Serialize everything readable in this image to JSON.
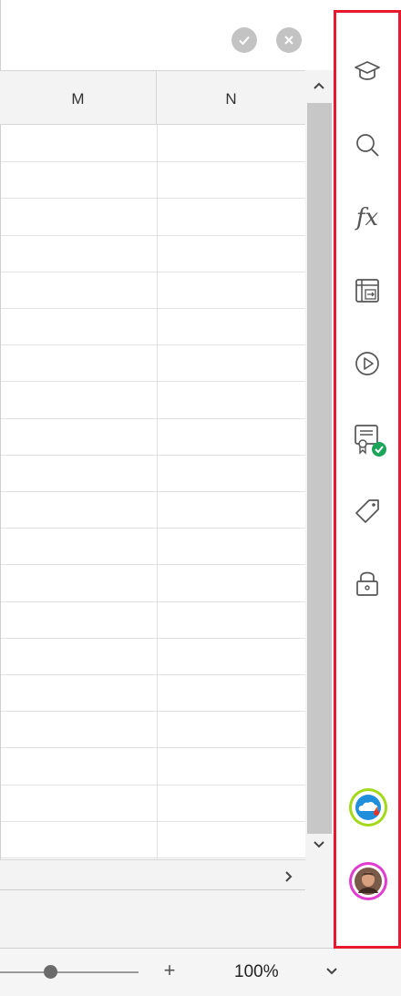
{
  "formula_bar": {
    "confirm_icon": "checkmark-icon",
    "cancel_icon": "close-icon"
  },
  "columns": [
    {
      "label": "M"
    },
    {
      "label": "N"
    }
  ],
  "grid": {
    "visible_rows": 20
  },
  "status_bar": {
    "zoom_in_label": "+",
    "zoom_value": "100%",
    "zoom_level": 1.0
  },
  "side_panel": {
    "tools": [
      {
        "icon": "graduation-cap-icon"
      },
      {
        "icon": "search-icon"
      },
      {
        "icon": "function-fx-icon",
        "label": "fx"
      },
      {
        "icon": "table-convert-icon"
      },
      {
        "icon": "play-icon"
      },
      {
        "icon": "certificate-verified-icon"
      },
      {
        "icon": "tag-icon"
      },
      {
        "icon": "lock-icon"
      }
    ],
    "bottom": [
      {
        "icon": "cloud-app-icon"
      },
      {
        "icon": "user-avatar"
      }
    ]
  },
  "colors": {
    "panel_border": "#e8192e",
    "verified_badge": "#1aa55a",
    "cloud_ring": "#a4d91a",
    "avatar_ring": "#e23bd0"
  }
}
